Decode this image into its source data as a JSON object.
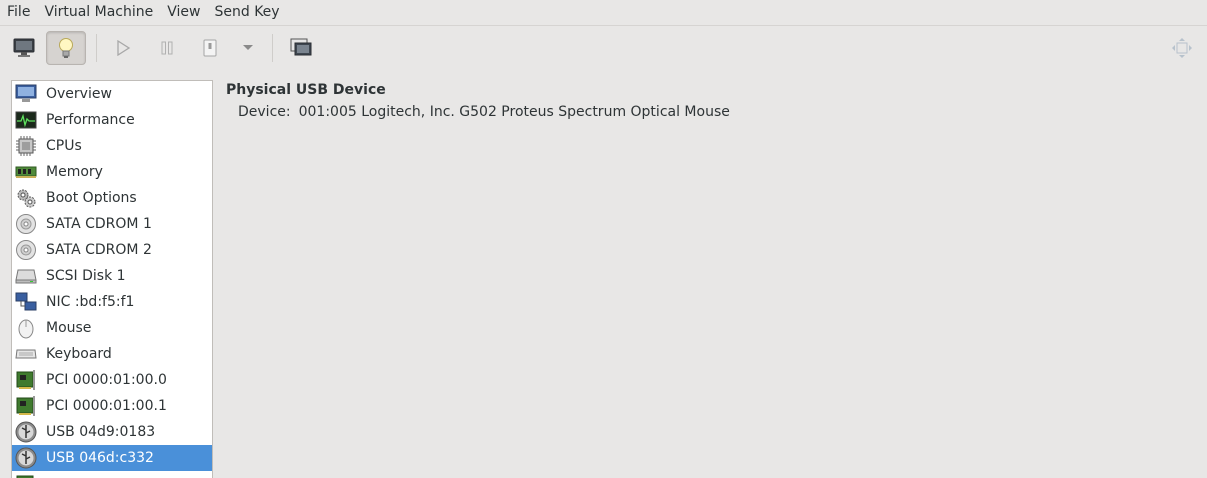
{
  "menubar": {
    "items": [
      "File",
      "Virtual Machine",
      "View",
      "Send Key"
    ]
  },
  "toolbar": {
    "buttons": [
      {
        "name": "console-icon",
        "active": false
      },
      {
        "name": "details-lightbulb-icon",
        "active": true
      },
      {
        "name": "run-icon",
        "active": false
      },
      {
        "name": "pause-icon",
        "active": false
      },
      {
        "name": "shutdown-icon",
        "active": false
      },
      {
        "name": "shutdown-menu-chevron-icon",
        "active": false
      },
      {
        "name": "snapshots-icon",
        "active": false
      },
      {
        "name": "fullscreen-icon",
        "active": false
      }
    ]
  },
  "sidebar": {
    "items": [
      {
        "label": "Overview",
        "icon": "monitor-icon"
      },
      {
        "label": "Performance",
        "icon": "performance-graph-icon"
      },
      {
        "label": "CPUs",
        "icon": "cpu-chip-icon"
      },
      {
        "label": "Memory",
        "icon": "memory-module-icon"
      },
      {
        "label": "Boot Options",
        "icon": "gears-icon"
      },
      {
        "label": "SATA CDROM 1",
        "icon": "cdrom-disc-icon"
      },
      {
        "label": "SATA CDROM 2",
        "icon": "cdrom-disc-icon"
      },
      {
        "label": "SCSI Disk 1",
        "icon": "hard-disk-icon"
      },
      {
        "label": "NIC :bd:f5:f1",
        "icon": "network-icon"
      },
      {
        "label": "Mouse",
        "icon": "mouse-icon"
      },
      {
        "label": "Keyboard",
        "icon": "keyboard-icon"
      },
      {
        "label": "PCI 0000:01:00.0",
        "icon": "pci-card-icon"
      },
      {
        "label": "PCI 0000:01:00.1",
        "icon": "pci-card-icon"
      },
      {
        "label": "USB 04d9:0183",
        "icon": "usb-icon"
      },
      {
        "label": "USB 046d:c332",
        "icon": "usb-icon",
        "selected": true
      }
    ]
  },
  "details": {
    "title": "Physical USB Device",
    "device_label": "Device:",
    "device_value": "001:005 Logitech, Inc. G502 Proteus Spectrum Optical Mouse"
  },
  "colors": {
    "selection": "#4a90d9",
    "background": "#e8e7e6"
  }
}
